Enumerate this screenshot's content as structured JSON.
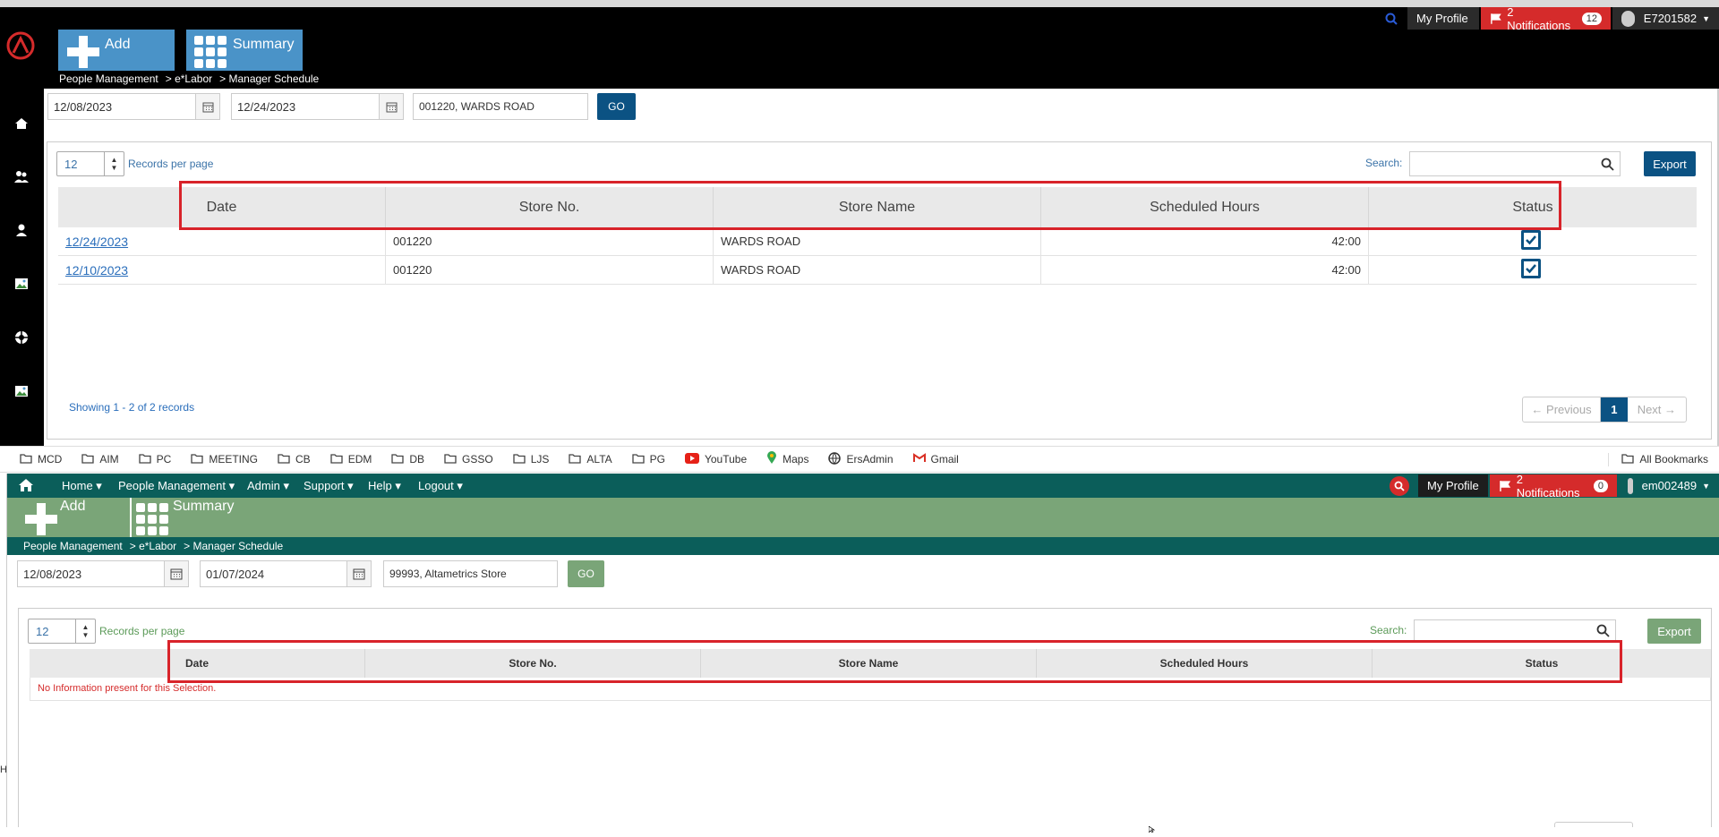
{
  "top_app": {
    "tiles": {
      "add": "Add",
      "summary": "Summary"
    },
    "header": {
      "my_profile": "My Profile",
      "notifications": "2 Notifications",
      "notif_count": "12",
      "user": "E7201582"
    },
    "breadcrumb": [
      "People Management",
      "> e*Labor",
      "> Manager Schedule"
    ],
    "filters": {
      "start_date": "12/08/2023",
      "end_date": "12/24/2023",
      "store": "001220, WARDS ROAD",
      "go": "GO"
    },
    "table": {
      "per_page": "12",
      "records_per_page_label": "Records per page",
      "search_label": "Search:",
      "export_label": "Export",
      "columns": [
        "Date",
        "Store No.",
        "Store Name",
        "Scheduled Hours",
        "Status"
      ],
      "rows": [
        {
          "date": "12/24/2023",
          "store_no": "001220",
          "store_name": "WARDS ROAD",
          "hours": "42:00",
          "status": "checked"
        },
        {
          "date": "12/10/2023",
          "store_no": "001220",
          "store_name": "WARDS ROAD",
          "hours": "42:00",
          "status": "checked"
        }
      ],
      "showing": "Showing 1 - 2 of 2 records",
      "pager": {
        "prev": "← Previous",
        "page": "1",
        "next": "Next →"
      }
    },
    "colors": {
      "accent": "#0b5283",
      "tile": "#4a93c8",
      "notif": "#d52b2b"
    }
  },
  "bookmarks": {
    "items": [
      "MCD",
      "AIM",
      "PC",
      "MEETING",
      "CB",
      "EDM",
      "DB",
      "GSSO",
      "LJS",
      "ALTA",
      "PG",
      "YouTube",
      "Maps",
      "ErsAdmin",
      "Gmail"
    ],
    "all": "All Bookmarks"
  },
  "bottom_app": {
    "nav": {
      "home": "Home",
      "people": "People Management",
      "admin": "Admin",
      "support": "Support",
      "help": "Help",
      "logout": "Logout"
    },
    "tiles": {
      "add": "Add",
      "summary": "Summary"
    },
    "header": {
      "my_profile": "My Profile",
      "notifications": "2 Notifications",
      "notif_count": "0",
      "user": "em002489"
    },
    "breadcrumb": [
      "People Management",
      "> e*Labor",
      "> Manager Schedule"
    ],
    "filters": {
      "start_date": "12/08/2023",
      "end_date": "01/07/2024",
      "store": "99993, Altametrics Store",
      "go": "GO"
    },
    "table": {
      "per_page": "12",
      "records_per_page_label": "Records per page",
      "search_label": "Search:",
      "export_label": "Export",
      "columns": [
        "Date",
        "Store No.",
        "Store Name",
        "Scheduled Hours",
        "Status"
      ],
      "empty": "No Information present for this Selection."
    },
    "colors": {
      "nav": "#0b5e5a",
      "tile": "#7aa578",
      "empty": "#d52b2b"
    }
  }
}
